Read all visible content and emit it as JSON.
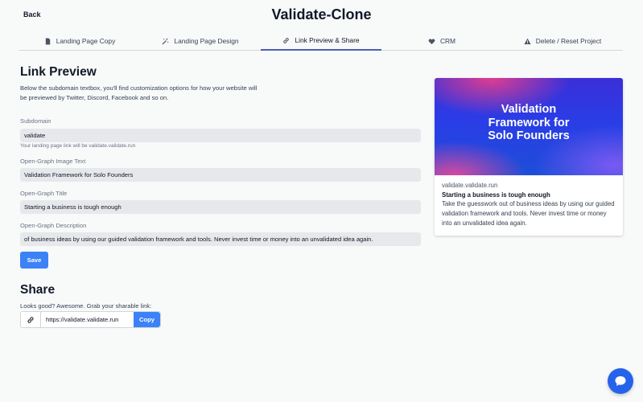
{
  "header": {
    "back_label": "Back",
    "title": "Validate-Clone"
  },
  "tabs": [
    {
      "label": "Landing Page Copy",
      "icon": "document-icon"
    },
    {
      "label": "Landing Page Design",
      "icon": "magic-wand-icon"
    },
    {
      "label": "Link Preview & Share",
      "icon": "link-icon",
      "active": true
    },
    {
      "label": "CRM",
      "icon": "heart-icon"
    },
    {
      "label": "Delete / Reset Project",
      "icon": "warning-icon"
    }
  ],
  "link_preview": {
    "heading": "Link Preview",
    "description": "Below the subdomain textbox, you'll find customization options for how your website will be previewed by Twitter, Discord, Facebook and so on.",
    "subdomain": {
      "label": "Subdomain",
      "value": "validate",
      "hint": "Your landing page link will be validate.validate.run"
    },
    "og_image_text": {
      "label": "Open-Graph Image Text",
      "value": "Validation Framework for Solo Founders"
    },
    "og_title": {
      "label": "Open-Graph Title",
      "value": "Starting a business is tough enough"
    },
    "og_description": {
      "label": "Open-Graph Description",
      "value": "of business ideas by using our guided validation framework and tools. Never invest time or money into an unvalidated idea again."
    },
    "save_label": "Save"
  },
  "preview_card": {
    "image_text": "Validation\nFramework for\nSolo Founders",
    "domain": "validate.validate.run",
    "title": "Starting a business is tough enough",
    "description": "Take the guesswork out of business ideas by using our guided validation framework and tools. Never invest time or money into an unvalidated idea again."
  },
  "share": {
    "heading": "Share",
    "text": "Looks good? Awesome. Grab your sharable link:",
    "url": "https://validate.validate.run",
    "copy_label": "Copy"
  },
  "colors": {
    "accent": "#3b82f6",
    "tab_active": "#4b5fae",
    "chat": "#2563eb"
  }
}
